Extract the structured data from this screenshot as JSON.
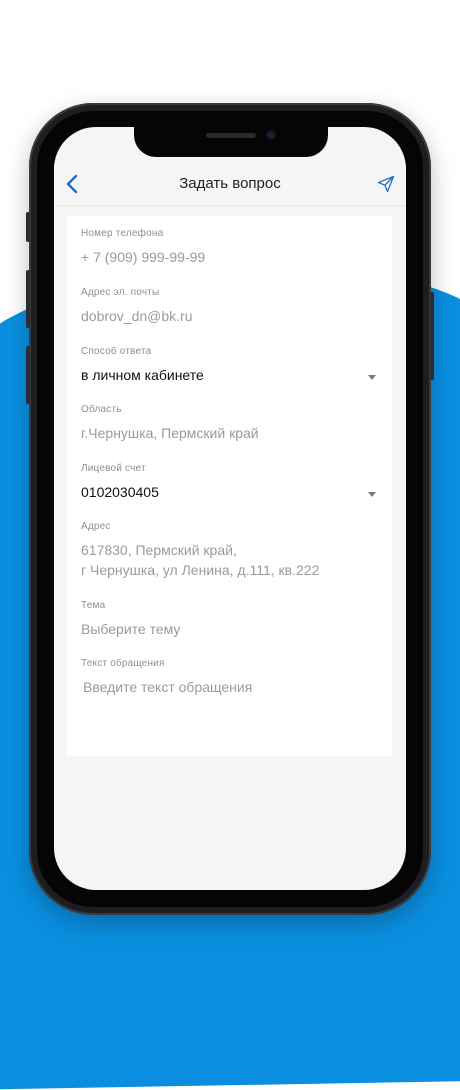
{
  "nav": {
    "title": "Задать вопрос",
    "back_icon": "chevron-left-icon",
    "send_icon": "send-icon"
  },
  "form": {
    "phone": {
      "label": "Номер телефона",
      "value": "+ 7 (909) 999-99-99"
    },
    "email": {
      "label": "Адрес эл. почты",
      "value": "dobrov_dn@bk.ru"
    },
    "answer_method": {
      "label": "Способ ответа",
      "value": "в личном кабинете"
    },
    "region": {
      "label": "Область",
      "value": "г.Чернушка, Пермский край"
    },
    "account": {
      "label": "Лицевой счет",
      "value": "0102030405"
    },
    "address": {
      "label": "Адрес",
      "line1": "617830, Пермский край,",
      "line2": "г Чернушка, ул Ленина, д.111, кв.222"
    },
    "topic": {
      "label": "Тема",
      "placeholder": "Выберите тему"
    },
    "text": {
      "label": "Текст обращения",
      "placeholder": "Введите текст обращения"
    }
  },
  "colors": {
    "accent": "#1a6fc2",
    "background_blue": "#0a8fe0"
  }
}
